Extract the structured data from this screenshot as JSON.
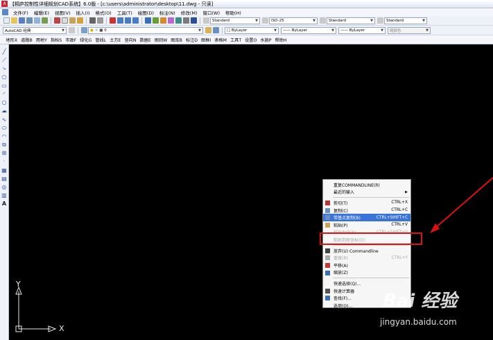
{
  "window": {
    "title": "【桐庐控制性详细规划CAD系统】6.0版 - [c:\\users\\administrator\\desktop\\11.dwg - 只读]",
    "app_icon_glyph": "A"
  },
  "menubar": {
    "items": [
      "文件(F)",
      "编辑(E)",
      "视图(V)",
      "插入(I)",
      "格式(O)",
      "工具(T)",
      "绘图(D)",
      "标注(N)",
      "修改(M)",
      "窗口(W)",
      "帮助(H)"
    ]
  },
  "toolbar": {
    "text_style": "Standard",
    "dim_style": "ISO-25",
    "table_style": "Standard",
    "multileader_style": "Standard",
    "workspace": "AutoCAD 经典",
    "layer": "0",
    "color": "ByLayer",
    "linetype": "ByLayer",
    "lineweight": "ByLayer",
    "plot_style": "随颜色"
  },
  "cn_menubar": {
    "items": [
      "地形X",
      "道路B",
      "用地Y",
      "指标S",
      "市政F",
      "绿化G",
      "管线L",
      "土方E",
      "竖向N",
      "数据E",
      "图则W",
      "图库B",
      "标注D",
      "图框I",
      "表格M",
      "工具T",
      "设置O",
      "水施P",
      "帮助H"
    ]
  },
  "left_tools": [
    "line",
    "construction-line",
    "polyline",
    "polygon",
    "rectangle",
    "arc",
    "circle",
    "revision-cloud",
    "spline",
    "ellipse",
    "ellipse-arc",
    "insert-block",
    "make-block",
    "point",
    "hatch",
    "gradient",
    "region",
    "table",
    "multiline-text"
  ],
  "ucs": {
    "x_label": "X",
    "y_label": "Y"
  },
  "context_menu": {
    "items": [
      {
        "label": "重复COMMANDLINE(R)",
        "shortcut": "",
        "state": "normal",
        "icon": ""
      },
      {
        "label": "最近的输入",
        "shortcut": "",
        "state": "submenu",
        "icon": ""
      },
      {
        "sep": true
      },
      {
        "label": "剪切(T)",
        "shortcut": "CTRL+X",
        "state": "normal",
        "icon": "cut-icon"
      },
      {
        "label": "复制(C)",
        "shortcut": "CTRL+C",
        "state": "normal",
        "icon": "copy-icon"
      },
      {
        "label": "带基点复制(B)",
        "shortcut": "CTRL+SHIFT+C",
        "state": "selected",
        "icon": "copy-base-icon"
      },
      {
        "label": "粘贴(P)",
        "shortcut": "CTRL+V",
        "state": "normal",
        "icon": "paste-icon"
      },
      {
        "label": "粘贴为块(K)",
        "shortcut": "CTRL+SHIFT+V",
        "state": "disabled",
        "icon": ""
      },
      {
        "label": "粘贴到原坐标(D)",
        "shortcut": "",
        "state": "disabled",
        "icon": ""
      },
      {
        "sep": true
      },
      {
        "label": "放弃(U) Commandline",
        "shortcut": "",
        "state": "normal",
        "icon": "undo-icon"
      },
      {
        "label": "重做(R)",
        "shortcut": "CTRL+Y",
        "state": "disabled",
        "icon": "redo-icon"
      },
      {
        "label": "平移(A)",
        "shortcut": "",
        "state": "normal",
        "icon": "pan-icon"
      },
      {
        "label": "缩放(Z)",
        "shortcut": "",
        "state": "normal",
        "icon": "zoom-icon"
      },
      {
        "sep": true
      },
      {
        "label": "快速选择(Q)...",
        "shortcut": "",
        "state": "normal",
        "icon": ""
      },
      {
        "label": "快速计算器",
        "shortcut": "",
        "state": "normal",
        "icon": "calculator-icon"
      },
      {
        "label": "查找(F)...",
        "shortcut": "",
        "state": "normal",
        "icon": "find-icon"
      },
      {
        "label": "选项(O)...",
        "shortcut": "",
        "state": "normal",
        "icon": ""
      }
    ]
  },
  "watermark": {
    "logo": "Bai 经验",
    "url": "jingyan.baidu.com"
  },
  "colors": {
    "highlight": "#3a74d8",
    "annotation_red": "#e01010",
    "canvas": "#000000"
  }
}
